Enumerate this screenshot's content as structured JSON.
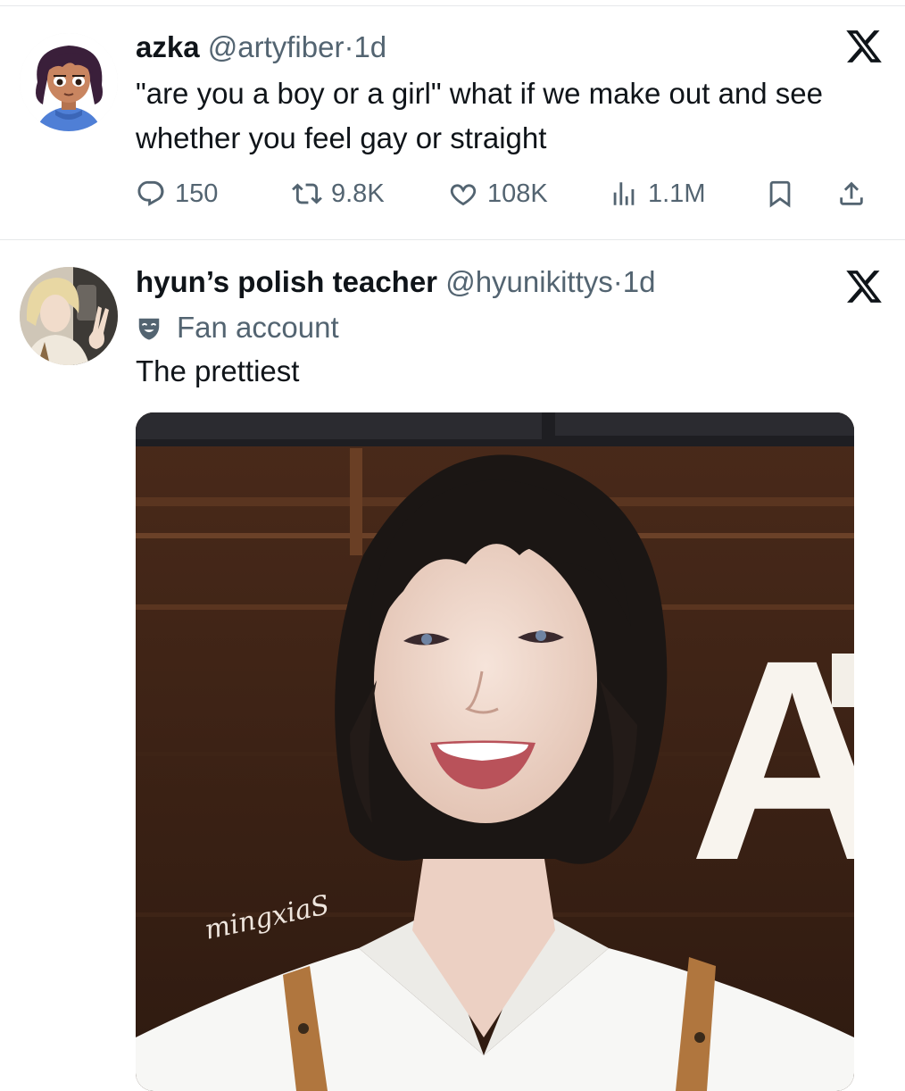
{
  "tweets": [
    {
      "display_name": "azka",
      "handle": "@artyfiber",
      "separator": "·",
      "time": "1d",
      "text": "\"are you a boy or a girl\" what if we make out and see whether you feel gay or straight",
      "stats": {
        "replies": "150",
        "retweets": "9.8K",
        "likes": "108K",
        "views": "1.1M"
      }
    },
    {
      "display_name": "hyun’s polish teacher",
      "handle": "@hyunikittys",
      "separator": "·",
      "time": "1d",
      "label": "Fan account",
      "text": "The prettiest",
      "media": {
        "watermark": "mingxiaS",
        "sign_letter": "A"
      }
    }
  ],
  "icons": {
    "platform": "x-logo-icon",
    "reply": "speech-bubble-icon",
    "retweet": "retweet-arrows-icon",
    "like": "heart-icon",
    "views": "bar-chart-icon",
    "bookmark": "bookmark-icon",
    "share": "upload-share-icon",
    "fan": "theater-mask-icon"
  },
  "colors": {
    "text_primary": "#0f1419",
    "text_secondary": "#536471",
    "divider": "#e6e8ea"
  }
}
